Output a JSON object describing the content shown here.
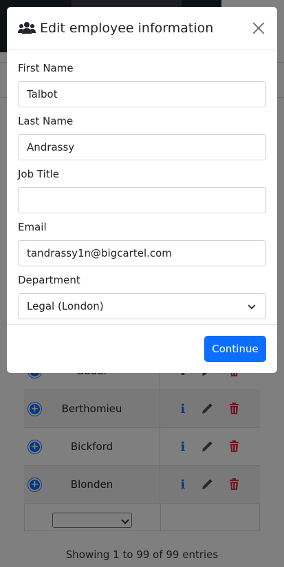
{
  "modal": {
    "title": "Edit employee information",
    "fields": {
      "first_name": {
        "label": "First Name",
        "value": "Talbot"
      },
      "last_name": {
        "label": "Last Name",
        "value": "Andrassy"
      },
      "job_title": {
        "label": "Job Title",
        "value": ""
      },
      "email": {
        "label": "Email",
        "value": "tandrassy1n@bigcartel.com"
      },
      "department": {
        "label": "Department",
        "value": "Legal (London)"
      }
    },
    "continue_label": "Continue"
  },
  "table": {
    "rows": [
      {
        "last_name": "Baudi"
      },
      {
        "last_name": "Berthomieu"
      },
      {
        "last_name": "Bickford"
      },
      {
        "last_name": "Blonden"
      }
    ],
    "info_glyph": "i",
    "expand_glyph": "+",
    "footer_text": "Showing 1 to 99 of 99 entries"
  },
  "colors": {
    "primary": "#0d6efd",
    "danger": "#dc3545",
    "backdrop": "rgba(0,0,0,0.5)"
  }
}
